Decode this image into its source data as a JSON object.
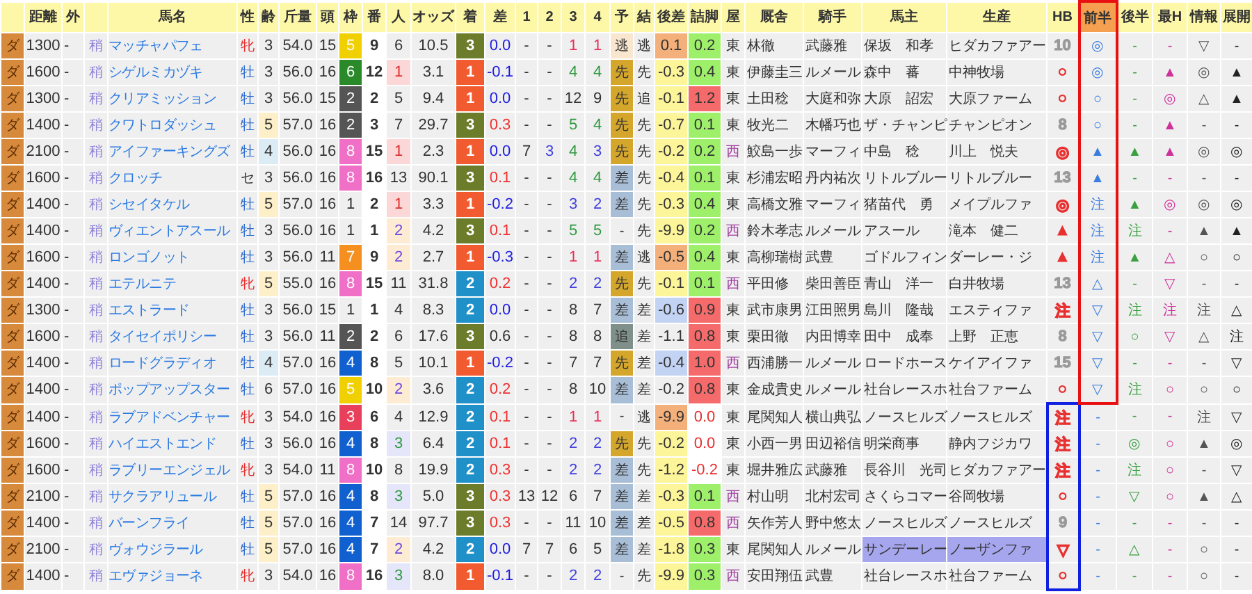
{
  "columns": [
    {
      "label": "距離",
      "selected": false
    },
    {
      "label": "外",
      "selected": false
    },
    {
      "label": "馬名",
      "selected": false
    },
    {
      "label": "性",
      "selected": false
    },
    {
      "label": "齢",
      "selected": false
    },
    {
      "label": "斤量",
      "selected": false
    },
    {
      "label": "頭",
      "selected": false
    },
    {
      "label": "枠",
      "selected": false
    },
    {
      "label": "番",
      "selected": false
    },
    {
      "label": "人",
      "selected": false
    },
    {
      "label": "オッズ",
      "selected": false
    },
    {
      "label": "着",
      "selected": false
    },
    {
      "label": "差",
      "selected": false
    },
    {
      "label": "1",
      "selected": false
    },
    {
      "label": "2",
      "selected": false
    },
    {
      "label": "3",
      "selected": false
    },
    {
      "label": "4",
      "selected": false
    },
    {
      "label": "予",
      "selected": false
    },
    {
      "label": "結",
      "selected": false
    },
    {
      "label": "後差",
      "selected": false
    },
    {
      "label": "詰脚",
      "selected": false
    },
    {
      "label": "屋",
      "selected": false
    },
    {
      "label": "厩舎",
      "selected": false
    },
    {
      "label": "騎手",
      "selected": false
    },
    {
      "label": "馬主",
      "selected": false
    },
    {
      "label": "生産",
      "selected": false
    },
    {
      "label": "HB",
      "selected": false
    },
    {
      "label": "前半",
      "selected": true
    },
    {
      "label": "後半",
      "selected": false
    },
    {
      "label": "最H",
      "selected": false
    },
    {
      "label": "情報",
      "selected": false
    },
    {
      "label": "展開",
      "selected": false
    }
  ],
  "rows": [
    {
      "kind": "front",
      "surface": "ダ",
      "dist": "1300",
      "outer": "-",
      "cond": "稍",
      "name": "マッチャパフェ",
      "sex": {
        "text": "牝",
        "kind": "mare"
      },
      "age": {
        "text": "3"
      },
      "weight": "54.0",
      "field": "15",
      "frame": {
        "text": "5",
        "color": "#f0d000"
      },
      "num": "9",
      "pop": {
        "text": "6"
      },
      "odds": "10.5",
      "finish": {
        "text": "3",
        "color": "#6b7d2a"
      },
      "diff": {
        "text": "0.0",
        "color": "#2020e0"
      },
      "corners": [
        {
          "text": "-"
        },
        {
          "text": "-"
        },
        {
          "text": "1",
          "color": "#e8305a"
        },
        {
          "text": "1",
          "color": "#e8305a"
        }
      ],
      "pred": {
        "text": "逃",
        "color": "#f9e6cf"
      },
      "result": "逃",
      "late": {
        "text": "0.1",
        "color": "#f4b07a"
      },
      "tsume": {
        "text": "0.2",
        "kind": "good"
      },
      "region": {
        "text": "東",
        "color": "#333333"
      },
      "trainer": "林徹",
      "jockey": "武藤雅",
      "owner": "保坂　和孝",
      "breeder": "ヒダカファアー",
      "highlighted": false,
      "hb": {
        "text": "10",
        "color": "#999999"
      },
      "marks": [
        "◎",
        "-",
        "-",
        "▽",
        "-"
      ]
    },
    {
      "kind": "front",
      "surface": "ダ",
      "dist": "1600",
      "outer": "-",
      "cond": "稍",
      "name": "シゲルミカヅキ",
      "sex": {
        "text": "牡",
        "kind": "horse"
      },
      "age": {
        "text": "3"
      },
      "weight": "56.0",
      "field": "16",
      "frame": {
        "text": "6",
        "color": "#2a8a2a"
      },
      "num": "12",
      "pop": {
        "text": "1",
        "kind": "first"
      },
      "odds": "3.1",
      "finish": {
        "text": "1",
        "color": "#f25a30"
      },
      "diff": {
        "text": "-0.1",
        "color": "#2020e0"
      },
      "corners": [
        {
          "text": "-"
        },
        {
          "text": "-"
        },
        {
          "text": "4",
          "color": "#2e9a40"
        },
        {
          "text": "4",
          "color": "#2e9a40"
        }
      ],
      "pred": {
        "text": "先",
        "color": "#d4a72c"
      },
      "result": "先",
      "late": {
        "text": "-0.3",
        "color": "#fdf59a"
      },
      "tsume": {
        "text": "0.4",
        "kind": "good"
      },
      "region": {
        "text": "東",
        "color": "#333333"
      },
      "trainer": "伊藤圭三",
      "jockey": "ルメール",
      "owner": "森中　蕃",
      "breeder": "中神牧場",
      "highlighted": false,
      "hb": {
        "text": "○",
        "color": "#e83030"
      },
      "marks": [
        "◎",
        "-",
        "▲",
        "◎",
        "▲"
      ]
    },
    {
      "kind": "front",
      "surface": "ダ",
      "dist": "1300",
      "outer": "-",
      "cond": "稍",
      "name": "クリアミッション",
      "sex": {
        "text": "牡",
        "kind": "horse"
      },
      "age": {
        "text": "3"
      },
      "weight": "56.0",
      "field": "15",
      "frame": {
        "text": "2",
        "color": "#555555"
      },
      "num": "2",
      "pop": {
        "text": "5"
      },
      "odds": "9.4",
      "finish": {
        "text": "1",
        "color": "#f25a30"
      },
      "diff": {
        "text": "0.0",
        "color": "#2020e0"
      },
      "corners": [
        {
          "text": "-"
        },
        {
          "text": "-"
        },
        {
          "text": "12"
        },
        {
          "text": "9"
        }
      ],
      "pred": {
        "text": "先",
        "color": "#d4a72c"
      },
      "result": "追",
      "late": {
        "text": "-0.1",
        "color": "#fdf59a"
      },
      "tsume": {
        "text": "1.2",
        "kind": "bad"
      },
      "region": {
        "text": "東",
        "color": "#333333"
      },
      "trainer": "土田稔",
      "jockey": "大庭和弥",
      "owner": "大原　詔宏",
      "breeder": "大原ファーム",
      "highlighted": false,
      "hb": {
        "text": "○",
        "color": "#e83030"
      },
      "marks": [
        "○",
        "-",
        "◎",
        "△",
        "▲"
      ]
    },
    {
      "kind": "front",
      "surface": "ダ",
      "dist": "1400",
      "outer": "-",
      "cond": "稍",
      "name": "クワトロダッシュ",
      "sex": {
        "text": "牡",
        "kind": "horse"
      },
      "age": {
        "text": "5",
        "color": "#fdf0c8"
      },
      "weight": "57.0",
      "field": "16",
      "frame": {
        "text": "2",
        "color": "#555555"
      },
      "num": "3",
      "pop": {
        "text": "7"
      },
      "odds": "29.7",
      "finish": {
        "text": "3",
        "color": "#6b7d2a"
      },
      "diff": {
        "text": "0.3",
        "color": "#f03030"
      },
      "corners": [
        {
          "text": "-"
        },
        {
          "text": "-"
        },
        {
          "text": "5",
          "color": "#2e9a40"
        },
        {
          "text": "4",
          "color": "#2e9a40"
        }
      ],
      "pred": {
        "text": "先",
        "color": "#d4a72c"
      },
      "result": "先",
      "late": {
        "text": "-0.7",
        "color": "#fdf59a"
      },
      "tsume": {
        "text": "0.1",
        "kind": "good"
      },
      "region": {
        "text": "東",
        "color": "#333333"
      },
      "trainer": "牧光二",
      "jockey": "木幡巧也",
      "owner": "ザ・チャンピ",
      "breeder": "チャンピオン",
      "highlighted": false,
      "hb": {
        "text": "8",
        "color": "#999999"
      },
      "marks": [
        "○",
        "-",
        "▲",
        "-",
        "-"
      ]
    },
    {
      "kind": "front",
      "surface": "ダ",
      "dist": "2100",
      "outer": "-",
      "cond": "稍",
      "name": "アイファーキングズ",
      "sex": {
        "text": "牡",
        "kind": "horse"
      },
      "age": {
        "text": "4",
        "color": "#dcecf5"
      },
      "weight": "56.0",
      "field": "16",
      "frame": {
        "text": "8",
        "color": "#f070c8"
      },
      "num": "15",
      "pop": {
        "text": "1",
        "kind": "first"
      },
      "odds": "2.3",
      "finish": {
        "text": "1",
        "color": "#f25a30"
      },
      "diff": {
        "text": "0.0",
        "color": "#2020e0"
      },
      "corners": [
        {
          "text": "7"
        },
        {
          "text": "3",
          "color": "#4040e0"
        },
        {
          "text": "4",
          "color": "#2e9a40"
        },
        {
          "text": "3",
          "color": "#4040e0"
        }
      ],
      "pred": {
        "text": "先",
        "color": "#d4a72c"
      },
      "result": "先",
      "late": {
        "text": "-0.2",
        "color": "#fdf59a"
      },
      "tsume": {
        "text": "0.2",
        "kind": "good"
      },
      "region": {
        "text": "西",
        "color": "#a040a0"
      },
      "trainer": "鮫島一歩",
      "jockey": "マーフィ",
      "owner": "中島　稔",
      "breeder": "川上　悦夫",
      "highlighted": false,
      "hb": {
        "text": "◎",
        "color": "#e83030"
      },
      "marks": [
        "▲",
        "▲",
        "▲",
        "◎",
        "◎"
      ]
    },
    {
      "kind": "front",
      "surface": "ダ",
      "dist": "1600",
      "outer": "-",
      "cond": "稍",
      "name": "クロッチ",
      "sex": {
        "text": "セ",
        "kind": "gelding"
      },
      "age": {
        "text": "3"
      },
      "weight": "56.0",
      "field": "16",
      "frame": {
        "text": "8",
        "color": "#f070c8"
      },
      "num": "16",
      "pop": {
        "text": "13"
      },
      "odds": "90.1",
      "finish": {
        "text": "3",
        "color": "#6b7d2a"
      },
      "diff": {
        "text": "0.1",
        "color": "#f03030"
      },
      "corners": [
        {
          "text": "-"
        },
        {
          "text": "-"
        },
        {
          "text": "4",
          "color": "#2e9a40"
        },
        {
          "text": "4",
          "color": "#2e9a40"
        }
      ],
      "pred": {
        "text": "差",
        "color": "#a8bdd6"
      },
      "result": "先",
      "late": {
        "text": "-0.4",
        "color": "#fdf59a"
      },
      "tsume": {
        "text": "0.1",
        "kind": "good"
      },
      "region": {
        "text": "東",
        "color": "#333333"
      },
      "trainer": "杉浦宏昭",
      "jockey": "丹内祐次",
      "owner": "リトルブルー",
      "breeder": "リトルブルー",
      "highlighted": false,
      "hb": {
        "text": "13",
        "color": "#999999"
      },
      "marks": [
        "▲",
        "-",
        "-",
        "-",
        "-"
      ]
    },
    {
      "kind": "front",
      "surface": "ダ",
      "dist": "1400",
      "outer": "-",
      "cond": "稍",
      "name": "シセイタケル",
      "sex": {
        "text": "牡",
        "kind": "horse"
      },
      "age": {
        "text": "5",
        "color": "#fdf0c8"
      },
      "weight": "57.0",
      "field": "16",
      "frame": {
        "text": "1"
      },
      "num": "2",
      "pop": {
        "text": "1",
        "kind": "first"
      },
      "odds": "3.3",
      "finish": {
        "text": "1",
        "color": "#f25a30"
      },
      "diff": {
        "text": "-0.2",
        "color": "#2020e0"
      },
      "corners": [
        {
          "text": "-"
        },
        {
          "text": "-"
        },
        {
          "text": "3",
          "color": "#4040e0"
        },
        {
          "text": "2",
          "color": "#4040e0"
        }
      ],
      "pred": {
        "text": "差",
        "color": "#a8bdd6"
      },
      "result": "先",
      "late": {
        "text": "-0.3",
        "color": "#fdf59a"
      },
      "tsume": {
        "text": "0.4",
        "kind": "good"
      },
      "region": {
        "text": "東",
        "color": "#333333"
      },
      "trainer": "高橋文雅",
      "jockey": "マーフィ",
      "owner": "猪苗代　勇",
      "breeder": "メイプルファ",
      "highlighted": false,
      "hb": {
        "text": "◎",
        "color": "#e83030"
      },
      "marks": [
        "注",
        "▲",
        "◎",
        "◎",
        "◎"
      ]
    },
    {
      "kind": "front",
      "surface": "ダ",
      "dist": "1400",
      "outer": "-",
      "cond": "稍",
      "name": "ヴィエントアスール",
      "sex": {
        "text": "牡",
        "kind": "horse"
      },
      "age": {
        "text": "3"
      },
      "weight": "56.0",
      "field": "16",
      "frame": {
        "text": "1"
      },
      "num": "1",
      "pop": {
        "text": "2",
        "kind": "second"
      },
      "odds": "4.2",
      "finish": {
        "text": "3",
        "color": "#6b7d2a"
      },
      "diff": {
        "text": "0.1",
        "color": "#f03030"
      },
      "corners": [
        {
          "text": "-"
        },
        {
          "text": "-"
        },
        {
          "text": "5",
          "color": "#2e9a40"
        },
        {
          "text": "5",
          "color": "#2e9a40"
        }
      ],
      "pred": {
        "text": "-"
      },
      "result": "先",
      "late": {
        "text": "-9.9",
        "color": "#fdf59a"
      },
      "tsume": {
        "text": "0.2",
        "kind": "good"
      },
      "region": {
        "text": "西",
        "color": "#a040a0"
      },
      "trainer": "鈴木孝志",
      "jockey": "ルメール",
      "owner": "アスール",
      "breeder": "滝本　健二",
      "highlighted": false,
      "hb": {
        "text": "▲",
        "color": "#e83030"
      },
      "marks": [
        "注",
        "注",
        "-",
        "▲",
        "▲"
      ]
    },
    {
      "kind": "front",
      "surface": "ダ",
      "dist": "1600",
      "outer": "-",
      "cond": "稍",
      "name": "ロンゴノット",
      "sex": {
        "text": "牡",
        "kind": "horse"
      },
      "age": {
        "text": "3"
      },
      "weight": "56.0",
      "field": "11",
      "frame": {
        "text": "7",
        "color": "#f59020"
      },
      "num": "9",
      "pop": {
        "text": "2",
        "kind": "second"
      },
      "odds": "2.7",
      "finish": {
        "text": "1",
        "color": "#f25a30"
      },
      "diff": {
        "text": "-0.3",
        "color": "#2020e0"
      },
      "corners": [
        {
          "text": "-"
        },
        {
          "text": "-"
        },
        {
          "text": "1",
          "color": "#e8305a"
        },
        {
          "text": "1",
          "color": "#e8305a"
        }
      ],
      "pred": {
        "text": "差",
        "color": "#a8bdd6"
      },
      "result": "逃",
      "late": {
        "text": "-0.5",
        "color": "#f4b07a"
      },
      "tsume": {
        "text": "0.4",
        "kind": "good"
      },
      "region": {
        "text": "東",
        "color": "#333333"
      },
      "trainer": "高柳瑞樹",
      "jockey": "武豊",
      "owner": "ゴドルフィン",
      "breeder": "ダーレー・ジ",
      "highlighted": false,
      "hb": {
        "text": "▲",
        "color": "#e83030"
      },
      "marks": [
        "注",
        "▲",
        "△",
        "○",
        "○"
      ]
    },
    {
      "kind": "front",
      "surface": "ダ",
      "dist": "1400",
      "outer": "-",
      "cond": "稍",
      "name": "エテルニテ",
      "sex": {
        "text": "牝",
        "kind": "mare"
      },
      "age": {
        "text": "5",
        "color": "#fdf0c8"
      },
      "weight": "55.0",
      "field": "16",
      "frame": {
        "text": "8",
        "color": "#f070c8"
      },
      "num": "15",
      "pop": {
        "text": "11"
      },
      "odds": "31.8",
      "finish": {
        "text": "2",
        "color": "#2090c8"
      },
      "diff": {
        "text": "0.2",
        "color": "#f03030"
      },
      "corners": [
        {
          "text": "-"
        },
        {
          "text": "-"
        },
        {
          "text": "2",
          "color": "#4040e0"
        },
        {
          "text": "2",
          "color": "#4040e0"
        }
      ],
      "pred": {
        "text": "先",
        "color": "#d4a72c"
      },
      "result": "先",
      "late": {
        "text": "-0.1",
        "color": "#fdf59a"
      },
      "tsume": {
        "text": "0.1",
        "kind": "good"
      },
      "region": {
        "text": "西",
        "color": "#a040a0"
      },
      "trainer": "平田修",
      "jockey": "柴田善臣",
      "owner": "青山　洋一",
      "breeder": "白井牧場",
      "highlighted": false,
      "hb": {
        "text": "13",
        "color": "#999999"
      },
      "marks": [
        "△",
        "-",
        "▽",
        "-",
        "-"
      ]
    },
    {
      "kind": "front",
      "surface": "ダ",
      "dist": "1300",
      "outer": "-",
      "cond": "稍",
      "name": "エストラード",
      "sex": {
        "text": "牡",
        "kind": "horse"
      },
      "age": {
        "text": "3"
      },
      "weight": "56.0",
      "field": "15",
      "frame": {
        "text": "1"
      },
      "num": "1",
      "pop": {
        "text": "4"
      },
      "odds": "8.3",
      "finish": {
        "text": "2",
        "color": "#2090c8"
      },
      "diff": {
        "text": "0.0",
        "color": "#2020e0"
      },
      "corners": [
        {
          "text": "-"
        },
        {
          "text": "-"
        },
        {
          "text": "8"
        },
        {
          "text": "7"
        }
      ],
      "pred": {
        "text": "差",
        "color": "#a8bdd6"
      },
      "result": "差",
      "late": {
        "text": "-0.6",
        "color": "#c3d3f3"
      },
      "tsume": {
        "text": "0.9",
        "kind": "bad"
      },
      "region": {
        "text": "東",
        "color": "#333333"
      },
      "trainer": "武市康男",
      "jockey": "江田照男",
      "owner": "島川　隆哉",
      "breeder": "エスティファ",
      "highlighted": false,
      "hb": {
        "text": "注",
        "color": "#e83030"
      },
      "marks": [
        "▽",
        "注",
        "注",
        "注",
        "△"
      ]
    },
    {
      "kind": "front",
      "surface": "ダ",
      "dist": "1600",
      "outer": "-",
      "cond": "稍",
      "name": "タイセイポリシー",
      "sex": {
        "text": "牡",
        "kind": "horse"
      },
      "age": {
        "text": "3"
      },
      "weight": "56.0",
      "field": "11",
      "frame": {
        "text": "2",
        "color": "#555555"
      },
      "num": "2",
      "pop": {
        "text": "6"
      },
      "odds": "17.6",
      "finish": {
        "text": "3",
        "color": "#6b7d2a"
      },
      "diff": {
        "text": "0.6",
        "color": "#333333"
      },
      "corners": [
        {
          "text": "-"
        },
        {
          "text": "-"
        },
        {
          "text": "8"
        },
        {
          "text": "8"
        }
      ],
      "pred": {
        "text": "追",
        "color": "#7f8f8a"
      },
      "result": "差",
      "late": {
        "text": "-1.1"
      },
      "tsume": {
        "text": "0.8",
        "kind": "bad"
      },
      "region": {
        "text": "東",
        "color": "#333333"
      },
      "trainer": "栗田徹",
      "jockey": "内田博幸",
      "owner": "田中　成奉",
      "breeder": "上野　正恵",
      "highlighted": false,
      "hb": {
        "text": "8",
        "color": "#999999"
      },
      "marks": [
        "▽",
        "○",
        "▽",
        "△",
        "注"
      ]
    },
    {
      "kind": "front",
      "surface": "ダ",
      "dist": "1400",
      "outer": "-",
      "cond": "稍",
      "name": "ロードグラディオ",
      "sex": {
        "text": "牡",
        "kind": "horse"
      },
      "age": {
        "text": "4",
        "color": "#dcecf5"
      },
      "weight": "57.0",
      "field": "16",
      "frame": {
        "text": "4",
        "color": "#1060d0"
      },
      "num": "8",
      "pop": {
        "text": "5"
      },
      "odds": "10.1",
      "finish": {
        "text": "1",
        "color": "#f25a30"
      },
      "diff": {
        "text": "-0.2",
        "color": "#2020e0"
      },
      "corners": [
        {
          "text": "-"
        },
        {
          "text": "-"
        },
        {
          "text": "7"
        },
        {
          "text": "7"
        }
      ],
      "pred": {
        "text": "先",
        "color": "#d4a72c"
      },
      "result": "差",
      "late": {
        "text": "-0.4",
        "color": "#c3d3f3"
      },
      "tsume": {
        "text": "1.0",
        "kind": "bad"
      },
      "region": {
        "text": "西",
        "color": "#a040a0"
      },
      "trainer": "西浦勝一",
      "jockey": "ルメール",
      "owner": "ロードホース",
      "breeder": "ケイアイファ",
      "highlighted": false,
      "hb": {
        "text": "15",
        "color": "#999999"
      },
      "marks": [
        "▽",
        "-",
        "-",
        "-",
        "▽"
      ]
    },
    {
      "kind": "front",
      "surface": "ダ",
      "dist": "1400",
      "outer": "-",
      "cond": "稍",
      "name": "ポップアップスター",
      "sex": {
        "text": "牡",
        "kind": "horse"
      },
      "age": {
        "text": "6"
      },
      "weight": "57.0",
      "field": "16",
      "frame": {
        "text": "5",
        "color": "#f0d000"
      },
      "num": "10",
      "pop": {
        "text": "2",
        "kind": "second"
      },
      "odds": "3.6",
      "finish": {
        "text": "2",
        "color": "#2090c8"
      },
      "diff": {
        "text": "0.2",
        "color": "#f03030"
      },
      "corners": [
        {
          "text": "-"
        },
        {
          "text": "-"
        },
        {
          "text": "8"
        },
        {
          "text": "10"
        }
      ],
      "pred": {
        "text": "差",
        "color": "#a8bdd6"
      },
      "result": "差",
      "late": {
        "text": "-0.2"
      },
      "tsume": {
        "text": "0.8",
        "kind": "bad"
      },
      "region": {
        "text": "東",
        "color": "#333333"
      },
      "trainer": "金成貴史",
      "jockey": "ルメール",
      "owner": "社台レースホ",
      "breeder": "社台ファーム",
      "highlighted": false,
      "hb": {
        "text": "○",
        "color": "#e83030"
      },
      "marks": [
        "▽",
        "注",
        "○",
        "○",
        "○"
      ]
    },
    {
      "kind": "hb",
      "surface": "ダ",
      "dist": "1400",
      "outer": "-",
      "cond": "稍",
      "name": "ラブアドベンチャー",
      "sex": {
        "text": "牝",
        "kind": "mare"
      },
      "age": {
        "text": "3"
      },
      "weight": "54.0",
      "field": "16",
      "frame": {
        "text": "3",
        "color": "#e8405a"
      },
      "num": "6",
      "pop": {
        "text": "4"
      },
      "odds": "12.9",
      "finish": {
        "text": "2",
        "color": "#2090c8"
      },
      "diff": {
        "text": "0.1",
        "color": "#f03030"
      },
      "corners": [
        {
          "text": "-"
        },
        {
          "text": "-"
        },
        {
          "text": "1",
          "color": "#e8305a"
        },
        {
          "text": "1",
          "color": "#e8305a"
        }
      ],
      "pred": {
        "text": "-"
      },
      "result": "逃",
      "late": {
        "text": "-9.9",
        "color": "#f4b07a"
      },
      "tsume": {
        "text": "0.0",
        "kind": "neg"
      },
      "region": {
        "text": "東",
        "color": "#333333"
      },
      "trainer": "尾関知人",
      "jockey": "横山典弘",
      "owner": "ノースヒルズ",
      "breeder": "ノースヒルズ",
      "highlighted": false,
      "hb": {
        "text": "注",
        "color": "#e83030"
      },
      "marks": [
        "-",
        "-",
        "-",
        "注",
        "▽"
      ]
    },
    {
      "kind": "hb",
      "surface": "ダ",
      "dist": "1600",
      "outer": "-",
      "cond": "稍",
      "name": "ハイエストエンド",
      "sex": {
        "text": "牡",
        "kind": "horse"
      },
      "age": {
        "text": "3"
      },
      "weight": "56.0",
      "field": "16",
      "frame": {
        "text": "4",
        "color": "#1060d0"
      },
      "num": "8",
      "pop": {
        "text": "3",
        "kind": "third"
      },
      "odds": "6.4",
      "finish": {
        "text": "2",
        "color": "#2090c8"
      },
      "diff": {
        "text": "0.1",
        "color": "#f03030"
      },
      "corners": [
        {
          "text": "-"
        },
        {
          "text": "-"
        },
        {
          "text": "2",
          "color": "#4040e0"
        },
        {
          "text": "2",
          "color": "#4040e0"
        }
      ],
      "pred": {
        "text": "先",
        "color": "#d4a72c"
      },
      "result": "先",
      "late": {
        "text": "-0.2",
        "color": "#fdf59a"
      },
      "tsume": {
        "text": "0.0",
        "kind": "neg"
      },
      "region": {
        "text": "東",
        "color": "#333333"
      },
      "trainer": "小西一男",
      "jockey": "田辺裕信",
      "owner": "明栄商事",
      "breeder": "静内フジカワ",
      "highlighted": false,
      "hb": {
        "text": "注",
        "color": "#e83030"
      },
      "marks": [
        "-",
        "◎",
        "○",
        "▲",
        "◎"
      ]
    },
    {
      "kind": "hb",
      "surface": "ダ",
      "dist": "1600",
      "outer": "-",
      "cond": "稍",
      "name": "ラブリーエンジェル",
      "sex": {
        "text": "牝",
        "kind": "mare"
      },
      "age": {
        "text": "3"
      },
      "weight": "54.0",
      "field": "11",
      "frame": {
        "text": "8",
        "color": "#f070c8"
      },
      "num": "10",
      "pop": {
        "text": "8"
      },
      "odds": "19.9",
      "finish": {
        "text": "2",
        "color": "#2090c8"
      },
      "diff": {
        "text": "0.3",
        "color": "#f03030"
      },
      "corners": [
        {
          "text": "-"
        },
        {
          "text": "-"
        },
        {
          "text": "2",
          "color": "#4040e0"
        },
        {
          "text": "2",
          "color": "#4040e0"
        }
      ],
      "pred": {
        "text": "差",
        "color": "#a8bdd6"
      },
      "result": "先",
      "late": {
        "text": "-1.2",
        "color": "#fdf59a"
      },
      "tsume": {
        "text": "-0.2",
        "kind": "neg"
      },
      "region": {
        "text": "東",
        "color": "#333333"
      },
      "trainer": "堀井雅広",
      "jockey": "武藤雅",
      "owner": "長谷川　光司",
      "breeder": "ヒダカファアー",
      "highlighted": false,
      "hb": {
        "text": "注",
        "color": "#e83030"
      },
      "marks": [
        "-",
        "注",
        "○",
        "-",
        "▽"
      ]
    },
    {
      "kind": "hb",
      "surface": "ダ",
      "dist": "2100",
      "outer": "-",
      "cond": "稍",
      "name": "サクラアリュール",
      "sex": {
        "text": "牡",
        "kind": "horse"
      },
      "age": {
        "text": "5",
        "color": "#fdf0c8"
      },
      "weight": "57.0",
      "field": "16",
      "frame": {
        "text": "4",
        "color": "#1060d0"
      },
      "num": "8",
      "pop": {
        "text": "3",
        "kind": "third"
      },
      "odds": "5.0",
      "finish": {
        "text": "3",
        "color": "#6b7d2a"
      },
      "diff": {
        "text": "0.3",
        "color": "#f03030"
      },
      "corners": [
        {
          "text": "13"
        },
        {
          "text": "12"
        },
        {
          "text": "6"
        },
        {
          "text": "7"
        }
      ],
      "pred": {
        "text": "差",
        "color": "#a8bdd6"
      },
      "result": "差",
      "late": {
        "text": "-0.3",
        "color": "#fdf59a"
      },
      "tsume": {
        "text": "0.1",
        "kind": "good"
      },
      "region": {
        "text": "西",
        "color": "#a040a0"
      },
      "trainer": "村山明",
      "jockey": "北村宏司",
      "owner": "さくらコマー",
      "breeder": "谷岡牧場",
      "highlighted": false,
      "hb": {
        "text": "○",
        "color": "#e83030"
      },
      "marks": [
        "-",
        "▽",
        "○",
        "▲",
        "△"
      ]
    },
    {
      "kind": "hb",
      "surface": "ダ",
      "dist": "1400",
      "outer": "-",
      "cond": "稍",
      "name": "バーンフライ",
      "sex": {
        "text": "牡",
        "kind": "horse"
      },
      "age": {
        "text": "5",
        "color": "#fdf0c8"
      },
      "weight": "57.0",
      "field": "16",
      "frame": {
        "text": "4",
        "color": "#1060d0"
      },
      "num": "7",
      "pop": {
        "text": "14"
      },
      "odds": "97.7",
      "finish": {
        "text": "3",
        "color": "#6b7d2a"
      },
      "diff": {
        "text": "0.3",
        "color": "#f03030"
      },
      "corners": [
        {
          "text": "-"
        },
        {
          "text": "-"
        },
        {
          "text": "11"
        },
        {
          "text": "10"
        }
      ],
      "pred": {
        "text": "差",
        "color": "#a8bdd6"
      },
      "result": "差",
      "late": {
        "text": "-0.5",
        "color": "#fdf59a"
      },
      "tsume": {
        "text": "0.8",
        "kind": "bad"
      },
      "region": {
        "text": "西",
        "color": "#a040a0"
      },
      "trainer": "矢作芳人",
      "jockey": "野中悠太",
      "owner": "ノースヒルズ",
      "breeder": "ノースヒルズ",
      "highlighted": false,
      "hb": {
        "text": "9",
        "color": "#999999"
      },
      "marks": [
        "-",
        "-",
        "-",
        "-",
        "-"
      ]
    },
    {
      "kind": "hb",
      "surface": "ダ",
      "dist": "2100",
      "outer": "-",
      "cond": "稍",
      "name": "ヴォウジラール",
      "sex": {
        "text": "牡",
        "kind": "horse"
      },
      "age": {
        "text": "5",
        "color": "#fdf0c8"
      },
      "weight": "57.0",
      "field": "16",
      "frame": {
        "text": "4",
        "color": "#1060d0"
      },
      "num": "7",
      "pop": {
        "text": "2",
        "kind": "second"
      },
      "odds": "4.2",
      "finish": {
        "text": "2",
        "color": "#2090c8"
      },
      "diff": {
        "text": "0.0",
        "color": "#2020e0"
      },
      "corners": [
        {
          "text": "7"
        },
        {
          "text": "7"
        },
        {
          "text": "6"
        },
        {
          "text": "5"
        }
      ],
      "pred": {
        "text": "差",
        "color": "#a8bdd6"
      },
      "result": "差",
      "late": {
        "text": "-1.8",
        "color": "#fdf59a"
      },
      "tsume": {
        "text": "0.3",
        "kind": "good"
      },
      "region": {
        "text": "東",
        "color": "#333333"
      },
      "trainer": "尾関知人",
      "jockey": "ルメール",
      "owner": "サンデーレー",
      "breeder": "ノーザンファ",
      "highlighted": true,
      "hb": {
        "text": "▽",
        "color": "#e83030"
      },
      "marks": [
        "-",
        "△",
        "-",
        "○",
        "-"
      ]
    },
    {
      "kind": "hb",
      "surface": "ダ",
      "dist": "1400",
      "outer": "-",
      "cond": "稍",
      "name": "エヴァジョーネ",
      "sex": {
        "text": "牝",
        "kind": "mare"
      },
      "age": {
        "text": "3"
      },
      "weight": "54.0",
      "field": "16",
      "frame": {
        "text": "8",
        "color": "#f070c8"
      },
      "num": "16",
      "pop": {
        "text": "3",
        "kind": "third"
      },
      "odds": "8.0",
      "finish": {
        "text": "1",
        "color": "#f25a30"
      },
      "diff": {
        "text": "-0.1",
        "color": "#2020e0"
      },
      "corners": [
        {
          "text": "-"
        },
        {
          "text": "-"
        },
        {
          "text": "2",
          "color": "#4040e0"
        },
        {
          "text": "2",
          "color": "#4040e0"
        }
      ],
      "pred": {
        "text": "-"
      },
      "result": "先",
      "late": {
        "text": "-9.9",
        "color": "#fdf59a"
      },
      "tsume": {
        "text": "0.3",
        "kind": "good"
      },
      "region": {
        "text": "西",
        "color": "#a040a0"
      },
      "trainer": "安田翔伍",
      "jockey": "武豊",
      "owner": "社台レースホ",
      "breeder": "社台ファーム",
      "highlighted": false,
      "hb": {
        "text": "○",
        "color": "#e83030"
      },
      "marks": [
        "-",
        "-",
        "-",
        "○",
        "-"
      ]
    }
  ]
}
